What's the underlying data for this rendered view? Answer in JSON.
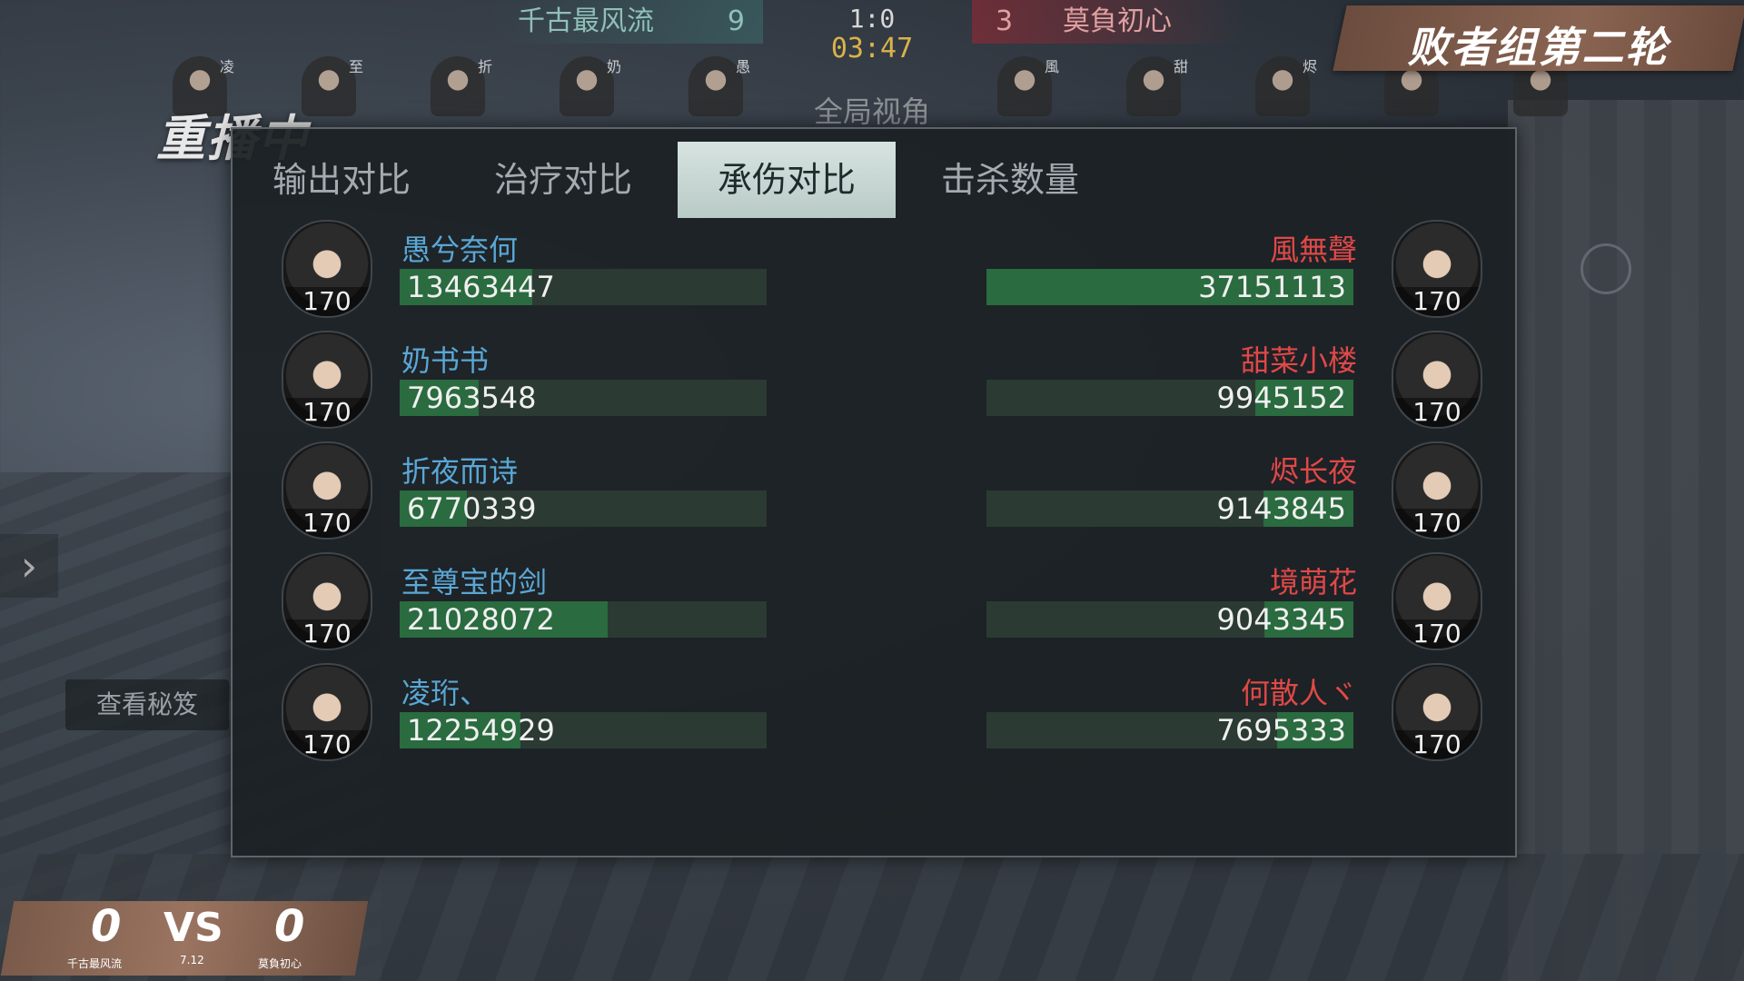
{
  "scoreboard": {
    "left_team": "千古最风流",
    "left_score": "9",
    "right_team": "莫負初心",
    "right_score": "3",
    "match_score": "1:0",
    "timer": "03:47",
    "view_mode": "全局视角",
    "left_tags": [
      "凌",
      "至",
      "折",
      "奶",
      "愚"
    ],
    "right_tags": [
      "風",
      "甜",
      "烬"
    ]
  },
  "round_banner": "败者组第二轮",
  "replay_label": "重播中",
  "secret_button": "查看秘笈",
  "tabs": [
    {
      "label": "输出对比",
      "active": false
    },
    {
      "label": "治疗对比",
      "active": false
    },
    {
      "label": "承伤对比",
      "active": true
    },
    {
      "label": "击杀数量",
      "active": false
    }
  ],
  "stats": {
    "left": [
      {
        "name": "愚兮奈何",
        "value": 13463447,
        "value_text": "13463447",
        "level": "170"
      },
      {
        "name": "奶书书",
        "value": 7963548,
        "value_text": "7963548",
        "level": "170"
      },
      {
        "name": "折夜而诗",
        "value": 6770339,
        "value_text": "6770339",
        "level": "170"
      },
      {
        "name": "至尊宝的剑",
        "value": 21028072,
        "value_text": "21028072",
        "level": "170"
      },
      {
        "name": "凌珩、",
        "value": 12254929,
        "value_text": "12254929",
        "level": "170"
      }
    ],
    "right": [
      {
        "name": "風無聲",
        "value": 37151113,
        "value_text": "37151113",
        "level": "170"
      },
      {
        "name": "甜菜小楼",
        "value": 9945152,
        "value_text": "9945152",
        "level": "170"
      },
      {
        "name": "烬长夜",
        "value": 9143845,
        "value_text": "9143845",
        "level": "170"
      },
      {
        "name": "境萌花",
        "value": 9043345,
        "value_text": "9043345",
        "level": "170"
      },
      {
        "name": "何散人ヾ",
        "value": 7695333,
        "value_text": "7695333",
        "level": "170"
      }
    ]
  },
  "bottom_score": {
    "left_team": "千古最风流",
    "left_score": "0",
    "vs": "VS",
    "version": "7.12",
    "right_team": "莫負初心",
    "right_score": "0"
  },
  "colors": {
    "left_name": "#5aa7d6",
    "right_name": "#e04848",
    "bar_fill": "#2a6b3f",
    "bar_bg": "#2b3a33",
    "active_tab": "#d7e3e0"
  }
}
